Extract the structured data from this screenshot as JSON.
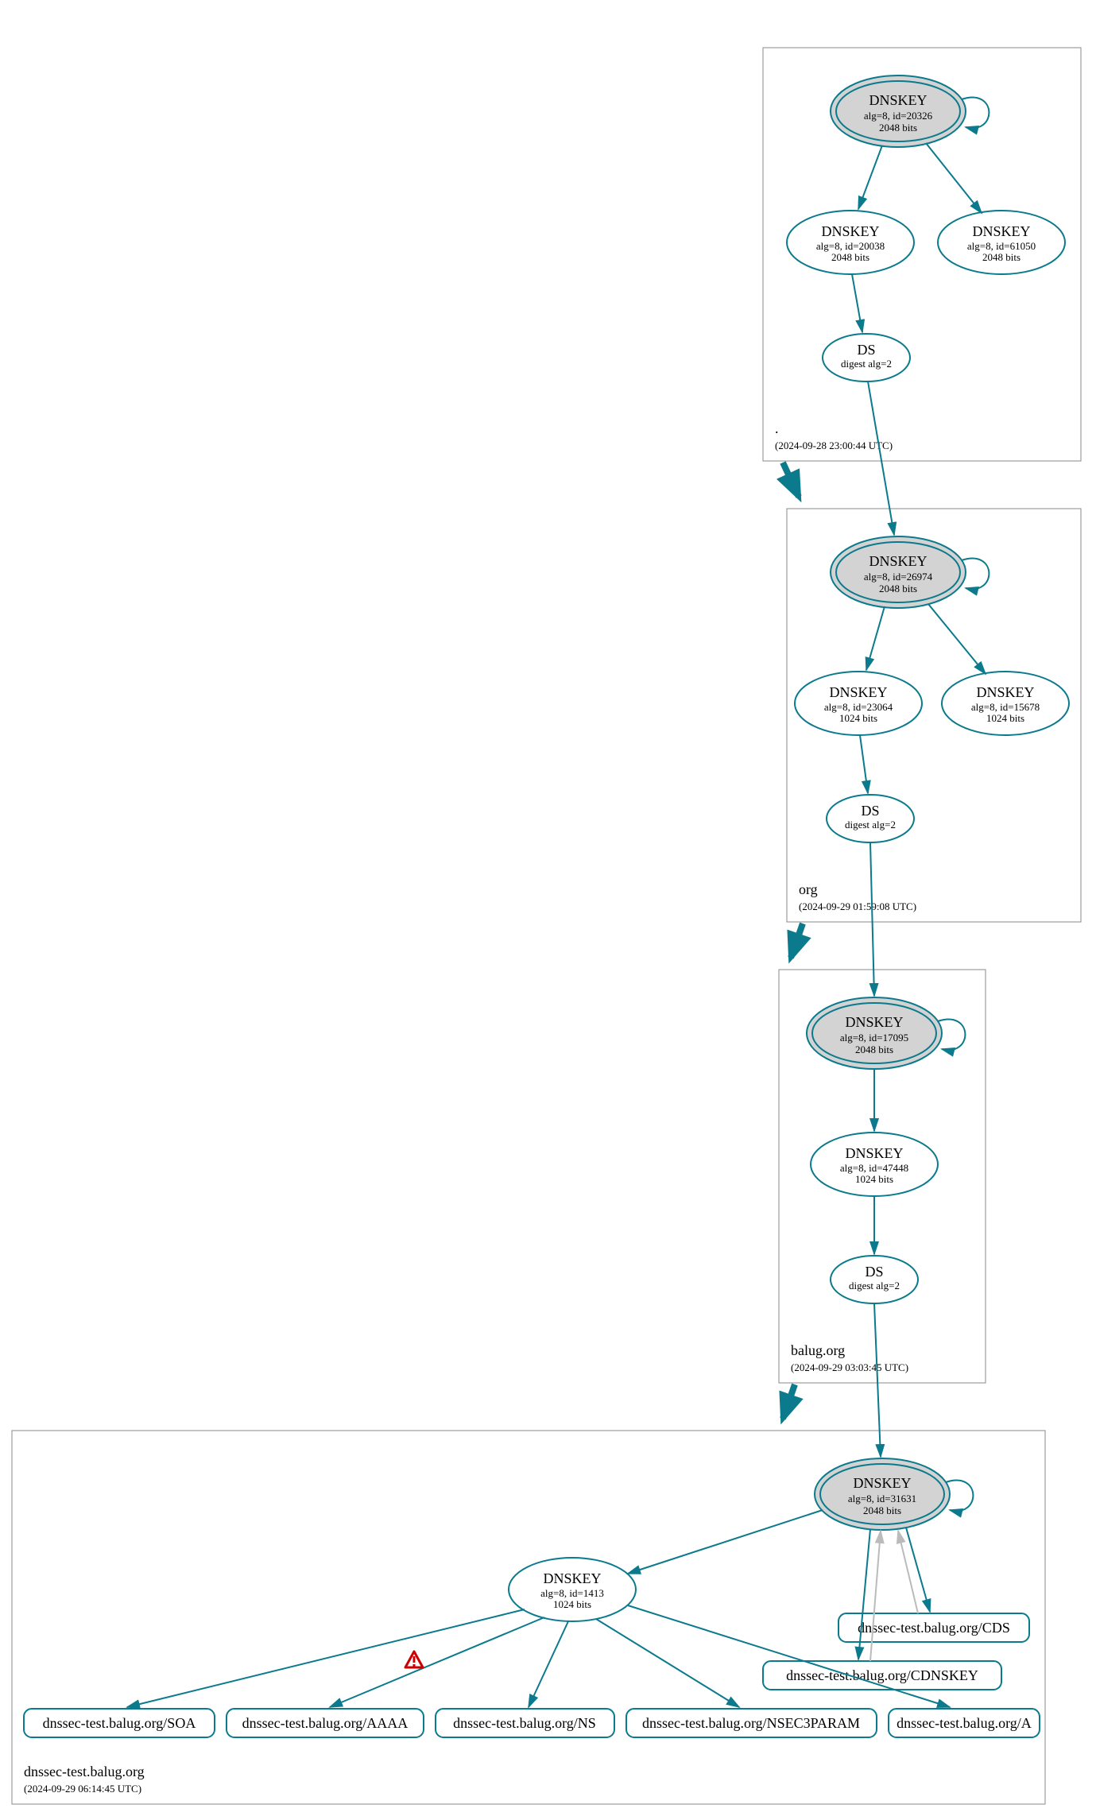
{
  "chart_data": {
    "type": "tree",
    "description": "DNSSEC authentication chain / DNSViz-style diagram",
    "zones": [
      {
        "name": ".",
        "timestamp": "(2024-09-28 23:00:44 UTC)",
        "nodes": [
          {
            "id": "root_ksk",
            "type": "ksk",
            "title": "DNSKEY",
            "line2": "alg=8, id=20326",
            "line3": "2048 bits"
          },
          {
            "id": "root_zsk1",
            "type": "zsk",
            "title": "DNSKEY",
            "line2": "alg=8, id=20038",
            "line3": "2048 bits"
          },
          {
            "id": "root_zsk2",
            "type": "zsk",
            "title": "DNSKEY",
            "line2": "alg=8, id=61050",
            "line3": "2048 bits"
          },
          {
            "id": "root_ds",
            "type": "ds",
            "title": "DS",
            "line2": "digest alg=2"
          }
        ]
      },
      {
        "name": "org",
        "timestamp": "(2024-09-29 01:59:08 UTC)",
        "nodes": [
          {
            "id": "org_ksk",
            "type": "ksk",
            "title": "DNSKEY",
            "line2": "alg=8, id=26974",
            "line3": "2048 bits"
          },
          {
            "id": "org_zsk1",
            "type": "zsk",
            "title": "DNSKEY",
            "line2": "alg=8, id=23064",
            "line3": "1024 bits"
          },
          {
            "id": "org_zsk2",
            "type": "zsk",
            "title": "DNSKEY",
            "line2": "alg=8, id=15678",
            "line3": "1024 bits"
          },
          {
            "id": "org_ds",
            "type": "ds",
            "title": "DS",
            "line2": "digest alg=2"
          }
        ]
      },
      {
        "name": "balug.org",
        "timestamp": "(2024-09-29 03:03:45 UTC)",
        "nodes": [
          {
            "id": "balug_ksk",
            "type": "ksk",
            "title": "DNSKEY",
            "line2": "alg=8, id=17095",
            "line3": "2048 bits"
          },
          {
            "id": "balug_zsk",
            "type": "zsk",
            "title": "DNSKEY",
            "line2": "alg=8, id=47448",
            "line3": "1024 bits"
          },
          {
            "id": "balug_ds",
            "type": "ds",
            "title": "DS",
            "line2": "digest alg=2"
          }
        ]
      },
      {
        "name": "dnssec-test.balug.org",
        "timestamp": "(2024-09-29 06:14:45 UTC)",
        "nodes": [
          {
            "id": "test_ksk",
            "type": "ksk",
            "title": "DNSKEY",
            "line2": "alg=8, id=31631",
            "line3": "2048 bits"
          },
          {
            "id": "test_zsk",
            "type": "zsk",
            "title": "DNSKEY",
            "line2": "alg=8, id=1413",
            "line3": "1024 bits"
          },
          {
            "id": "rr_soa",
            "type": "rrset",
            "label": "dnssec-test.balug.org/SOA"
          },
          {
            "id": "rr_aaaa",
            "type": "rrset",
            "label": "dnssec-test.balug.org/AAAA"
          },
          {
            "id": "rr_ns",
            "type": "rrset",
            "label": "dnssec-test.balug.org/NS"
          },
          {
            "id": "rr_nsec3",
            "type": "rrset",
            "label": "dnssec-test.balug.org/NSEC3PARAM"
          },
          {
            "id": "rr_a",
            "type": "rrset",
            "label": "dnssec-test.balug.org/A"
          },
          {
            "id": "rr_cdnskey",
            "type": "rrset",
            "label": "dnssec-test.balug.org/CDNSKEY"
          },
          {
            "id": "rr_cds",
            "type": "rrset",
            "label": "dnssec-test.balug.org/CDS"
          }
        ]
      }
    ],
    "edges": [
      {
        "from": "root_ksk",
        "to": "root_ksk",
        "self": true
      },
      {
        "from": "root_ksk",
        "to": "root_zsk1"
      },
      {
        "from": "root_ksk",
        "to": "root_zsk2"
      },
      {
        "from": "root_zsk1",
        "to": "root_ds"
      },
      {
        "from": "root_ds",
        "to": "org_ksk"
      },
      {
        "from": "org_ksk",
        "to": "org_ksk",
        "self": true
      },
      {
        "from": "org_ksk",
        "to": "org_zsk1"
      },
      {
        "from": "org_ksk",
        "to": "org_zsk2"
      },
      {
        "from": "org_zsk1",
        "to": "org_ds"
      },
      {
        "from": "org_ds",
        "to": "balug_ksk"
      },
      {
        "from": "balug_ksk",
        "to": "balug_ksk",
        "self": true
      },
      {
        "from": "balug_ksk",
        "to": "balug_zsk"
      },
      {
        "from": "balug_zsk",
        "to": "balug_ds"
      },
      {
        "from": "balug_ds",
        "to": "test_ksk"
      },
      {
        "from": "test_ksk",
        "to": "test_ksk",
        "self": true
      },
      {
        "from": "test_ksk",
        "to": "test_zsk"
      },
      {
        "from": "test_zsk",
        "to": "rr_soa"
      },
      {
        "from": "test_zsk",
        "to": "rr_aaaa",
        "warning": true
      },
      {
        "from": "test_zsk",
        "to": "rr_ns"
      },
      {
        "from": "test_zsk",
        "to": "rr_nsec3"
      },
      {
        "from": "test_zsk",
        "to": "rr_a"
      },
      {
        "from": "test_ksk",
        "to": "rr_cdnskey"
      },
      {
        "from": "test_ksk",
        "to": "rr_cds"
      },
      {
        "from": "rr_cds",
        "to": "test_ksk",
        "style": "light"
      },
      {
        "from": "rr_cdnskey",
        "to": "test_ksk",
        "style": "light"
      }
    ],
    "zone_arrows": [
      {
        "from": ".",
        "to": "org"
      },
      {
        "from": "org",
        "to": "balug.org"
      },
      {
        "from": "balug.org",
        "to": "dnssec-test.balug.org"
      }
    ]
  }
}
